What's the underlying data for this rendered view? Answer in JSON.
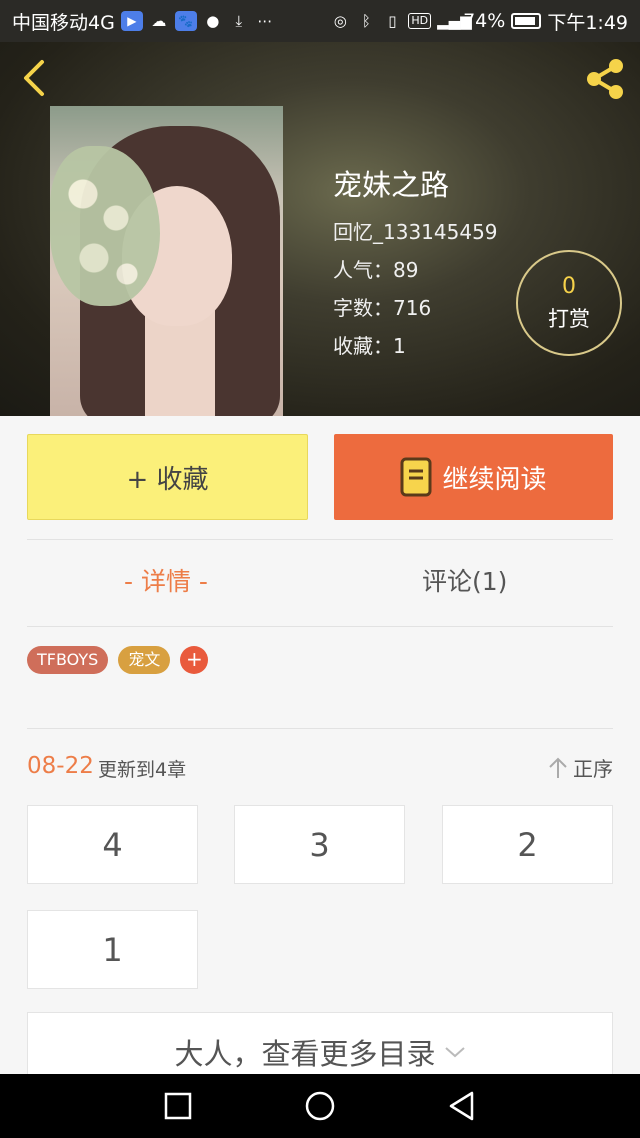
{
  "status_bar": {
    "carrier": "中国移动4G",
    "battery": "74%",
    "time": "下午1:49",
    "icons": [
      "play-app-icon",
      "cloud-icon",
      "baidu-icon",
      "wechat-icon",
      "download-icon",
      "more-dots-icon",
      "hotspot-icon",
      "bluetooth-icon",
      "vibrate-icon",
      "hd-icon",
      "signal-icon",
      "battery-icon"
    ]
  },
  "book": {
    "title": "宠妹之路",
    "author": "回忆_133145459",
    "popularity": "人气：89",
    "word_count": "字数：716",
    "favorites": "收藏：1",
    "reward_count": "0",
    "reward_label": "打赏"
  },
  "actions": {
    "collect_label": "+ 收藏",
    "read_label": "继续阅读"
  },
  "tabs": {
    "detail": "- 详情 -",
    "comment": "评论(1)"
  },
  "tags": [
    "TFBOYS",
    "宠文"
  ],
  "tag_add": "+",
  "update": {
    "date": "08-22",
    "text": "更新到4章",
    "sort_label": "正序"
  },
  "chapters": [
    "4",
    "3",
    "2",
    "1"
  ],
  "more_label": "大人，查看更多目录",
  "colors": {
    "accent_orange": "#ed6b3e",
    "collect_yellow": "#fbf07a",
    "reward_gold": "#f6d24a"
  }
}
